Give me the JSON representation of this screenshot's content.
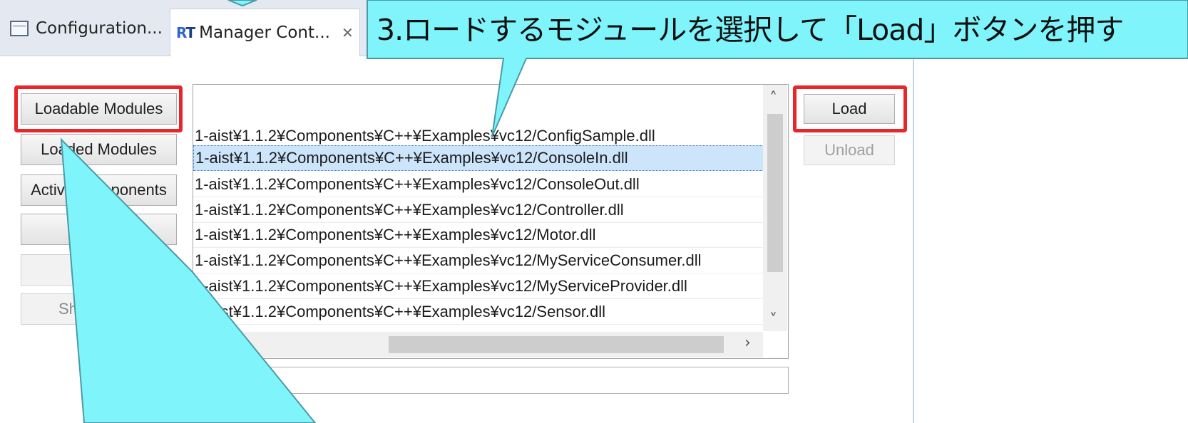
{
  "tabs": [
    {
      "label": "Configuration...",
      "icon": "configuration-view-icon"
    },
    {
      "label": "Manager Cont...",
      "icon": "rt-manager-icon",
      "active": true
    }
  ],
  "left_buttons": [
    {
      "label": "Loadable Modules",
      "enabled": true,
      "highlighted": true
    },
    {
      "label": "Loaded Modules",
      "enabled": true
    },
    {
      "label": "Active Components",
      "enabled": true
    },
    {
      "label": "",
      "enabled": true
    },
    {
      "label": "",
      "enabled": false
    },
    {
      "label": "Sh",
      "enabled": false
    }
  ],
  "module_list": {
    "items": [
      "1-aist¥1.1.2¥Components¥C++¥Examples¥vc12/ConfigSample.dll",
      "1-aist¥1.1.2¥Components¥C++¥Examples¥vc12/ConsoleIn.dll",
      "1-aist¥1.1.2¥Components¥C++¥Examples¥vc12/ConsoleOut.dll",
      "1-aist¥1.1.2¥Components¥C++¥Examples¥vc12/Controller.dll",
      "1-aist¥1.1.2¥Components¥C++¥Examples¥vc12/Motor.dll",
      "1-aist¥1.1.2¥Components¥C++¥Examples¥vc12/MyServiceConsumer.dll",
      "1-aist¥1.1.2¥Components¥C++¥Examples¥vc12/MyServiceProvider.dll",
      "1-aist¥1.1.2¥Components¥C++¥Examples¥vc12/Sensor.dll"
    ],
    "selected_index": 1
  },
  "right_buttons": {
    "load": "Load",
    "unload": "Unload"
  },
  "callout": {
    "text": "3.ロードするモジュールを選択して「Load」ボタンを押す",
    "fill": "#7ff5fb",
    "highlight_color": "#e8262a"
  },
  "colors": {
    "selection": "#cde5fb",
    "tabbar": "#e4e9f1"
  }
}
